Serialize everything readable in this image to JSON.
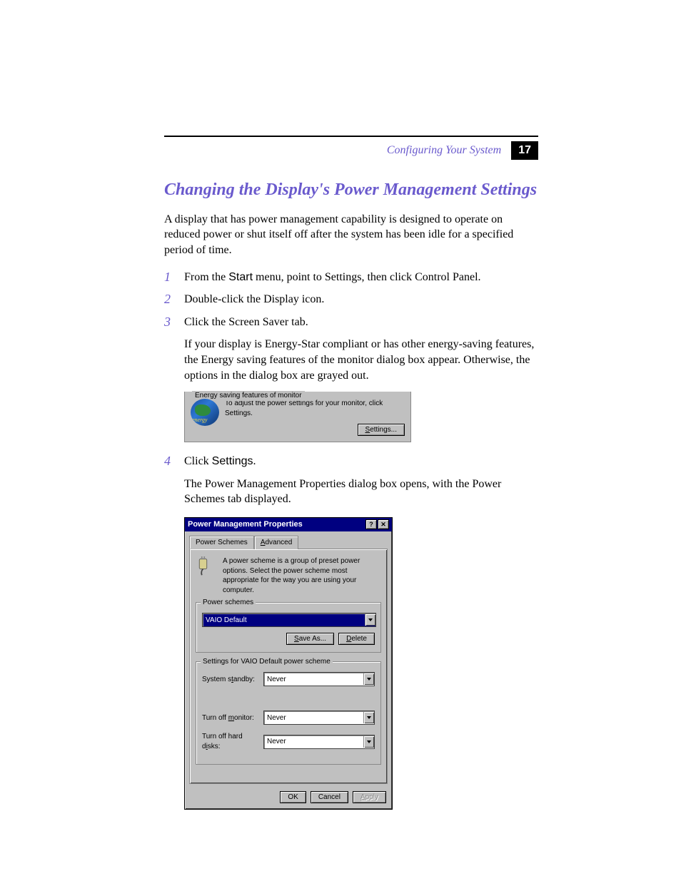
{
  "header": {
    "section": "Configuring Your System",
    "page_number": "17"
  },
  "title": "Changing the Display's Power Management Settings",
  "intro": "A display that has power management capability is designed to operate on reduced power or shut itself off after the system has been idle for a specified period of time.",
  "steps": {
    "s1": {
      "num": "1",
      "prefix": "From the ",
      "bold": "Start",
      "suffix": " menu, point to Settings, then click Control Panel."
    },
    "s2": {
      "num": "2",
      "text": "Double-click the Display icon."
    },
    "s3": {
      "num": "3",
      "text": "Click the Screen Saver tab.",
      "extra": "If your display is Energy-Star compliant or has other energy-saving features, the Energy saving features of the monitor dialog box appear. Otherwise, the options in the dialog box are grayed out."
    },
    "s4": {
      "num": "4",
      "prefix": "Click ",
      "bold": "Settings",
      "suffix": ".",
      "extra": "The Power Management Properties dialog box opens, with the Power Schemes tab displayed."
    }
  },
  "esf": {
    "legend": "Energy saving features of monitor",
    "text": "To adjust the power settings for your monitor, click Settings.",
    "settings_btn": "Settings..."
  },
  "pmp": {
    "title": "Power Management Properties",
    "tabs": {
      "schemes": "Power Schemes",
      "advanced": "Advanced"
    },
    "description": "A power scheme is a group of preset power options. Select the power scheme most appropriate for the way you are using your computer.",
    "schemes_group": {
      "legend": "Power schemes",
      "selected": "VAIO Default",
      "save_as": "Save As...",
      "delete": "Delete"
    },
    "settings_group": {
      "legend": "Settings for VAIO Default power scheme",
      "standby": {
        "label": "System standby:",
        "value": "Never"
      },
      "monitor": {
        "label": "Turn off monitor:",
        "value": "Never"
      },
      "disks": {
        "label": "Turn off hard disks:",
        "value": "Never"
      }
    },
    "buttons": {
      "ok": "OK",
      "cancel": "Cancel",
      "apply": "Apply"
    }
  }
}
